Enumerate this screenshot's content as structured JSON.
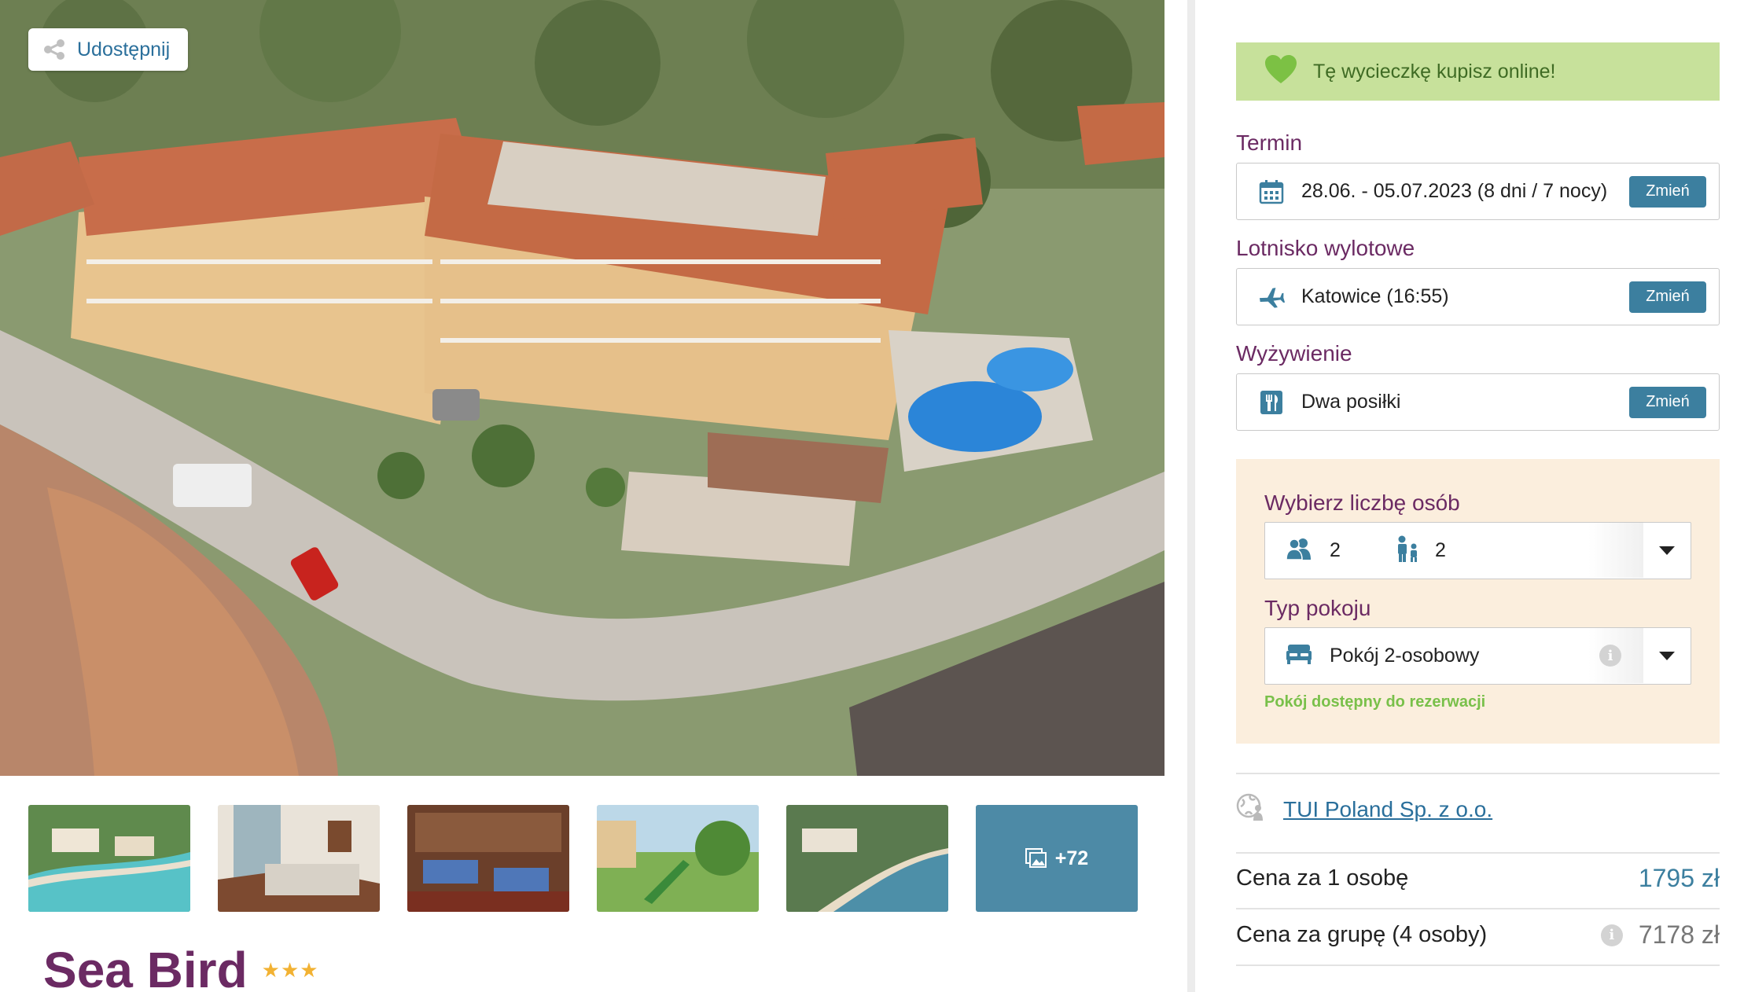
{
  "share": {
    "label": "Udostępnij"
  },
  "gallery": {
    "more_count": "+72"
  },
  "hotel": {
    "name": "Sea Bird",
    "stars": "★★★",
    "star_rating": 3
  },
  "booking": {
    "online_banner": "Tę wycieczkę kupisz online!",
    "term": {
      "label": "Termin",
      "value": "28.06. - 05.07.2023 (8 dni / 7 nocy)",
      "change": "Zmień"
    },
    "airport": {
      "label": "Lotnisko wylotowe",
      "value": "Katowice (16:55)",
      "change": "Zmień"
    },
    "board": {
      "label": "Wyżywienie",
      "value": "Dwa posiłki",
      "change": "Zmień"
    },
    "persons": {
      "label": "Wybierz liczbę osób",
      "adults": "2",
      "children": "2"
    },
    "room": {
      "label": "Typ pokoju",
      "value": "Pokój 2-osobowy",
      "availability": "Pokój dostępny do rezerwacji"
    }
  },
  "operator": {
    "name": "TUI Poland Sp. z o.o."
  },
  "prices": {
    "per_person_label": "Cena za 1 osobę",
    "per_person_value": "1795 zł",
    "group_label": "Cena za grupę (4 osoby)",
    "group_value": "7178 zł"
  },
  "colors": {
    "accent_purple": "#6b2a63",
    "accent_blue": "#3c7f9f",
    "banner_green": "#c7e19b",
    "panel_cream": "#fbeedd",
    "star_gold": "#f2b233"
  }
}
